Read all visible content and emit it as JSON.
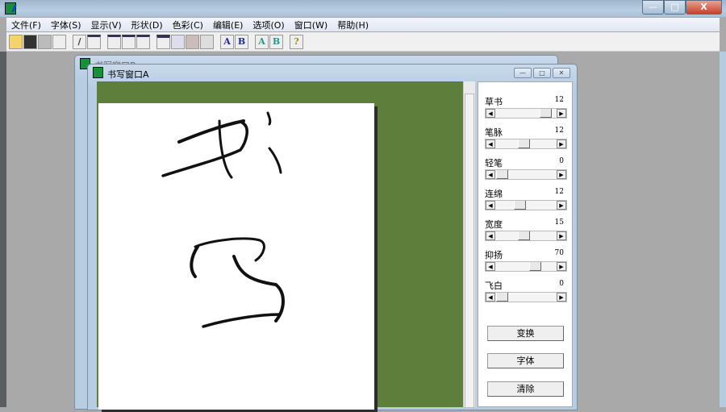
{
  "app": {
    "title": "",
    "window_buttons": {
      "minimize": "—",
      "maximize": "□",
      "close": "X"
    }
  },
  "menu": [
    "文件(F)",
    "字体(S)",
    "显示(V)",
    "形状(D)",
    "色彩(C)",
    "编辑(E)",
    "选项(O)",
    "窗口(W)",
    "帮助(H)"
  ],
  "toolbar": {
    "groups": [
      [
        "open-icon",
        "save-icon",
        "print-icon",
        "preview-icon"
      ],
      [
        "pen-icon",
        "frame-icon"
      ],
      [
        "layout1-icon",
        "layout2-icon",
        "layout3-icon"
      ],
      [
        "window-icon",
        "copy-icon",
        "paste-icon",
        "clipboard-icon"
      ],
      [
        "A",
        "B"
      ],
      [
        "A",
        "B"
      ],
      [
        "?"
      ]
    ]
  },
  "back_window": {
    "title": "书写窗口B"
  },
  "front_window": {
    "title": "书写窗口A",
    "buttons": {
      "min": "—",
      "max": "□",
      "close": "✕"
    }
  },
  "sliders": [
    {
      "label": "草书",
      "value": "12",
      "position": 0.92
    },
    {
      "label": "笔脉",
      "value": "12",
      "position": 0.45
    },
    {
      "label": "轻笔",
      "value": "0",
      "position": 0.0
    },
    {
      "label": "连绵",
      "value": "12",
      "position": 0.38
    },
    {
      "label": "宽度",
      "value": "15",
      "position": 0.45
    },
    {
      "label": "抑扬",
      "value": "70",
      "position": 0.7
    },
    {
      "label": "飞白",
      "value": "0",
      "position": 0.0
    }
  ],
  "buttons": {
    "transform": "变换",
    "font": "字体",
    "clear": "清除"
  },
  "colors": {
    "canvas": "#5e7e3c",
    "mdi": "#a9a9a9"
  }
}
